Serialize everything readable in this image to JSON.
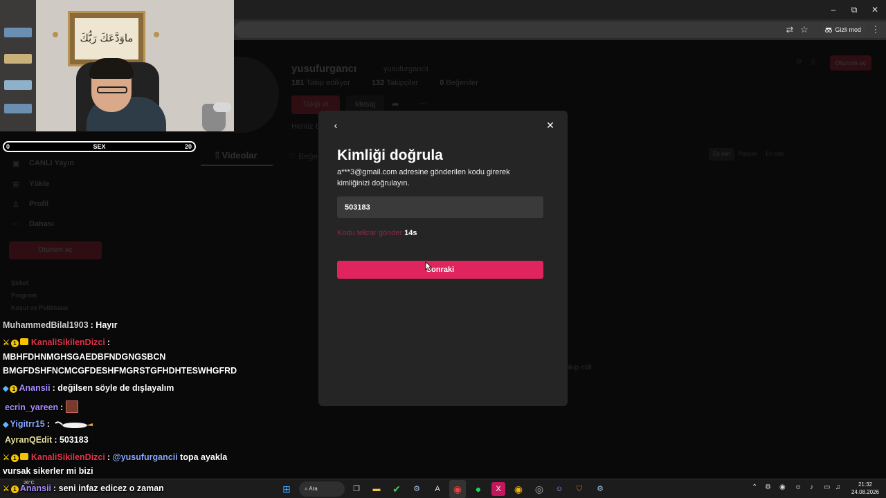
{
  "browser": {
    "incognito_label": "Gizli mod",
    "window_controls": {
      "minimize": "–",
      "restore": "⧉",
      "close": "✕"
    },
    "icons": [
      "translate-icon",
      "bookmark-star-icon",
      "incognito-icon",
      "menu-dots-icon"
    ]
  },
  "profile": {
    "username": "yusufurgancı",
    "handle": "yusufurgancii",
    "following_count": "181",
    "following_label": "Takip ediliyor",
    "followers_count": "132",
    "followers_label": "Takipçiler",
    "likes_count": "0",
    "likes_label": "Beğeniler",
    "follow_button": "Takip et",
    "message_button": "Mesaj",
    "bio_partial": "Henüz b",
    "tab_videos": "Videolar",
    "tab_liked_partial": "Beğe",
    "sort_tabs": [
      "En son",
      "Popüler",
      "En eski"
    ],
    "login_button": "Oturum aç",
    "empty_partial": "akip edil"
  },
  "sidebar": {
    "items": [
      {
        "label": "CANLI Yayın",
        "icon": "live-icon"
      },
      {
        "label": "Yükle",
        "icon": "upload-icon"
      },
      {
        "label": "Profil",
        "icon": "profile-icon"
      },
      {
        "label": "Dahası",
        "icon": "more-icon"
      }
    ],
    "login_button": "Oturum aç",
    "footer_links": [
      "Şirket",
      "Program",
      "Koşul ve Politikalar"
    ],
    "hidden_partial": "Takip ediliyor"
  },
  "stream": {
    "goal_left": "0",
    "goal_label": "SEX",
    "goal_right": "20",
    "frame_text": "ماوَدَّعَكَ رَبُّكَ وَمَا قَلَى"
  },
  "chat": [
    {
      "user": "MuhammedBilal1903",
      "color": "#cfcfcf",
      "text": ": Hayır"
    },
    {
      "user": "KanaliSikilenDizci",
      "color": "#e8344f",
      "text": ":"
    },
    {
      "user": "",
      "color": "#ffffff",
      "text": "MBHFDHNMGHSGAEDBFNDGNGSBCN"
    },
    {
      "user": "",
      "color": "#ffffff",
      "text": "BMGFDSHFNCMCGFDESHFMGRSTGFHDHTESWHGFRD"
    },
    {
      "user": "Anansii",
      "color": "#a98cff",
      "text": ": değilsen söyle de dışlayalım"
    },
    {
      "user": "ecrin_yareen",
      "color": "#a98cff",
      "text": ":"
    },
    {
      "user": "Yigitrr15",
      "color": "#8aa8ff",
      "text": ":"
    },
    {
      "user": "AyranQEdit",
      "color": "#e8e3a0",
      "text": ": 503183"
    },
    {
      "user": "KanaliSikilenDizci",
      "color": "#e8344f",
      "text": ":",
      "mention": "@yusufurgancii",
      "rest": "topa ayakla"
    },
    {
      "user": "",
      "color": "#ffffff",
      "text": "vursak sikerler mi bizi"
    },
    {
      "user": "Anansii",
      "color": "#a98cff",
      "text": ": seni infaz edicez o zaman"
    }
  ],
  "modal": {
    "title": "Kimliği doğrula",
    "description": "a***3@gmail.com adresine gönderilen kodu girerek kimliğinizi doğrulayın.",
    "code_value": "503183",
    "resend_link": "Kodu tekrar gönder",
    "resend_timer": "14s",
    "next_button": "Sonraki",
    "accent": "#e0245e"
  },
  "taskbar": {
    "weather": "26°C",
    "search_label": "Ara",
    "time": "21:32",
    "date": "24.08.2026",
    "apps": [
      "windows-start-icon",
      "task-view-icon",
      "file-explorer-icon",
      "checkmark-app-icon",
      "steam-icon",
      "app-a-icon",
      "chrome-icon",
      "spotify-icon",
      "x-app-icon",
      "chrome-alt-icon",
      "chrome-canary-icon",
      "discord-icon",
      "brave-icon",
      "steam-alt-icon"
    ]
  }
}
